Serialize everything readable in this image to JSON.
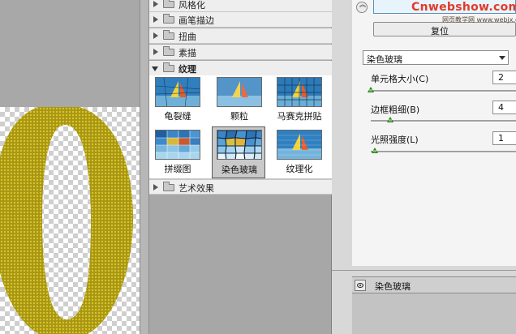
{
  "gallery": {
    "categories_top": [
      {
        "label": "风格化"
      },
      {
        "label": "画笔描边"
      },
      {
        "label": "扭曲"
      },
      {
        "label": "素描"
      }
    ],
    "open_category": {
      "label": "纹理"
    },
    "thumbnails": [
      {
        "label": "龟裂缝"
      },
      {
        "label": "颗粒"
      },
      {
        "label": "马赛克拼贴"
      },
      {
        "label": "拼缀图"
      },
      {
        "label": "染色玻璃",
        "selected": true
      },
      {
        "label": "纹理化"
      }
    ],
    "categories_bottom": [
      {
        "label": "艺术效果"
      }
    ]
  },
  "settings": {
    "ok_label": "",
    "reset_label": "复位",
    "filter_select": {
      "value": "染色玻璃"
    },
    "params": [
      {
        "label": "单元格大小(C)",
        "value": "2",
        "fraction": 0.0
      },
      {
        "label": "边框粗细(B)",
        "value": "4",
        "fraction": 0.14
      },
      {
        "label": "光照强度(L)",
        "value": "1",
        "fraction": 0.03
      }
    ],
    "layer": {
      "name": "染色玻璃"
    }
  },
  "watermark": {
    "main": "Cnwebshow.com",
    "sub": "网页教学网 www.webjx.com"
  },
  "colors": {
    "letter_gold": "#b5a216",
    "panel_bg": "#f4f4f4",
    "gallery_bg": "#a7a7a7"
  }
}
